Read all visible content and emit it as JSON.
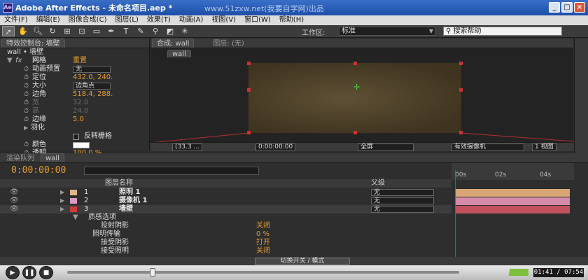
{
  "window": {
    "app_icon": "Ae",
    "title": "Adobe After Effects - 未命名项目.aep *",
    "watermark": "www.51zxw.net(我要自学网)出品",
    "buttons": [
      "_",
      "□",
      "×"
    ]
  },
  "menu": [
    "文件(F)",
    "编辑(E)",
    "图像合成(C)",
    "图层(L)",
    "效果(T)",
    "动画(A)",
    "视图(V)",
    "窗口(W)",
    "帮助(H)"
  ],
  "toolbar": {
    "tools": [
      "selection-tool-icon",
      "hand-tool-icon",
      "zoom-tool-icon",
      "rotate-tool-icon",
      "camera-tool-icon",
      "pan-tool-icon",
      "rectangle-tool-icon",
      "pen-tool-icon",
      "text-tool-icon",
      "brush-tool-icon",
      "clone-tool-icon",
      "eraser-tool-icon",
      "puppet-tool-icon"
    ],
    "workspace_label": "工作区:",
    "workspace_value": "标准",
    "search_placeholder": "搜索帮助"
  },
  "effect_controls": {
    "tab": "特效控制台: 墙壁",
    "subtitle": "wall • 墙壁",
    "effect_name": "网格",
    "reset_label": "重置",
    "rows": [
      {
        "label": "动画预置",
        "value": "无",
        "type": "select"
      },
      {
        "label": "定位",
        "value": "432.0, 240.",
        "type": "value"
      },
      {
        "label": "大小",
        "value": "边角点",
        "type": "select"
      },
      {
        "label": "边角",
        "value": "518.4, 288.",
        "type": "value"
      },
      {
        "label": "宽",
        "value": "32.0",
        "type": "dim"
      },
      {
        "label": "高",
        "value": "24.0",
        "type": "dim"
      },
      {
        "label": "边缘",
        "value": "5.0",
        "type": "value"
      },
      {
        "label": "羽化",
        "value": "",
        "type": "group"
      },
      {
        "label": "反转栅格",
        "value": "",
        "type": "checkbox"
      },
      {
        "label": "颜色",
        "value": "",
        "type": "color"
      },
      {
        "label": "透明",
        "value": "100.0 %",
        "type": "value"
      }
    ]
  },
  "composition": {
    "tab": "合成: wall",
    "layer_tab": "图层: (无)",
    "sub_tab": "wall",
    "footer": {
      "zoom": "(33.3 ...",
      "timecode": "0:00:00:00",
      "resolution": "全屏",
      "camera": "有效摄像机",
      "views": "1 视图"
    }
  },
  "timeline": {
    "tabs": [
      "渲染队列",
      "wall"
    ],
    "timecode": "0:00:00:00",
    "col_source": "图层名称",
    "col_parent": "父级",
    "layers": [
      {
        "num": "1",
        "name": "照明 1",
        "color": "#e0b48a",
        "parent": "无",
        "bar": "#d8a577"
      },
      {
        "num": "2",
        "name": "摄像机 1",
        "color": "#d79ac0",
        "parent": "无",
        "bar": "#d48aa8"
      },
      {
        "num": "3",
        "name": "墙壁",
        "color": "#cc3b3b",
        "parent": "无",
        "bar": "#c2535e"
      }
    ],
    "material_group": "质感选项",
    "material": [
      {
        "label": "投射阴影",
        "value": "关闭"
      },
      {
        "label": "照明传输",
        "value": "0 %"
      },
      {
        "label": "接受阴影",
        "value": "打开"
      },
      {
        "label": "接受照明",
        "value": "关闭"
      }
    ],
    "ruler": [
      "00s",
      "02s",
      "04s"
    ],
    "switch_modes": "切换开关 / 模式"
  },
  "player": {
    "time": "01:41 / 07:54",
    "progress_fraction": 0.21
  }
}
